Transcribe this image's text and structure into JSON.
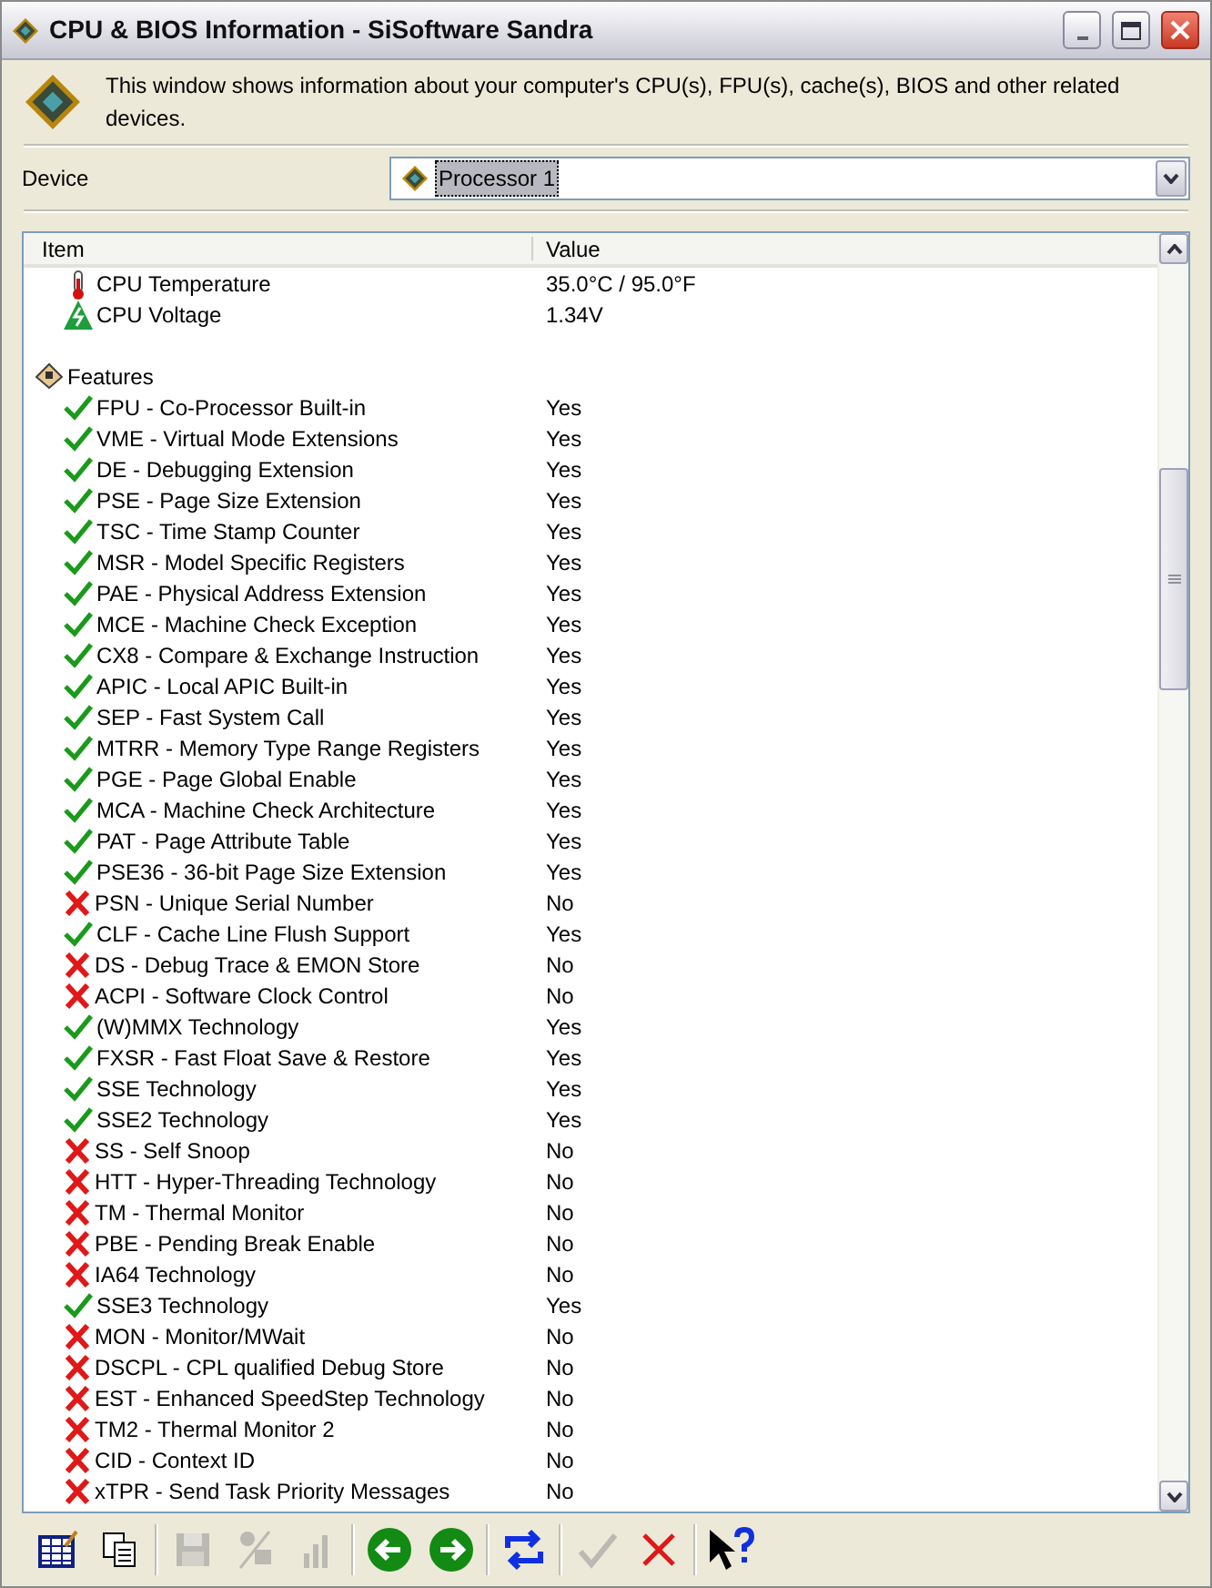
{
  "window": {
    "title": "CPU & BIOS Information - SiSoftware Sandra"
  },
  "description": "This window shows information about your computer's CPU(s), FPU(s), cache(s), BIOS and other related devices.",
  "device": {
    "label": "Device",
    "value": "Processor 1"
  },
  "table": {
    "columns": [
      "Item",
      "Value"
    ],
    "sensors": [
      {
        "kind": "temperature",
        "item": "CPU Temperature",
        "value": "35.0°C / 95.0°F"
      },
      {
        "kind": "voltage",
        "item": "CPU Voltage",
        "value": "1.34V"
      }
    ],
    "features": {
      "title": "Features",
      "items": [
        {
          "item": "FPU - Co-Processor Built-in",
          "value": "Yes",
          "supported": true
        },
        {
          "item": "VME - Virtual Mode Extensions",
          "value": "Yes",
          "supported": true
        },
        {
          "item": "DE - Debugging Extension",
          "value": "Yes",
          "supported": true
        },
        {
          "item": "PSE - Page Size Extension",
          "value": "Yes",
          "supported": true
        },
        {
          "item": "TSC - Time Stamp Counter",
          "value": "Yes",
          "supported": true
        },
        {
          "item": "MSR - Model Specific Registers",
          "value": "Yes",
          "supported": true
        },
        {
          "item": "PAE - Physical Address Extension",
          "value": "Yes",
          "supported": true
        },
        {
          "item": "MCE - Machine Check Exception",
          "value": "Yes",
          "supported": true
        },
        {
          "item": "CX8 - Compare & Exchange Instruction",
          "value": "Yes",
          "supported": true
        },
        {
          "item": "APIC - Local APIC Built-in",
          "value": "Yes",
          "supported": true
        },
        {
          "item": "SEP - Fast System Call",
          "value": "Yes",
          "supported": true
        },
        {
          "item": "MTRR - Memory Type Range Registers",
          "value": "Yes",
          "supported": true
        },
        {
          "item": "PGE - Page Global Enable",
          "value": "Yes",
          "supported": true
        },
        {
          "item": "MCA - Machine Check Architecture",
          "value": "Yes",
          "supported": true
        },
        {
          "item": "PAT - Page Attribute Table",
          "value": "Yes",
          "supported": true
        },
        {
          "item": "PSE36 - 36-bit Page Size Extension",
          "value": "Yes",
          "supported": true
        },
        {
          "item": "PSN - Unique Serial Number",
          "value": "No",
          "supported": false
        },
        {
          "item": "CLF - Cache Line Flush Support",
          "value": "Yes",
          "supported": true
        },
        {
          "item": "DS - Debug Trace & EMON Store",
          "value": "No",
          "supported": false
        },
        {
          "item": "ACPI - Software Clock Control",
          "value": "No",
          "supported": false
        },
        {
          "item": "(W)MMX Technology",
          "value": "Yes",
          "supported": true
        },
        {
          "item": "FXSR - Fast Float Save & Restore",
          "value": "Yes",
          "supported": true
        },
        {
          "item": "SSE Technology",
          "value": "Yes",
          "supported": true
        },
        {
          "item": "SSE2 Technology",
          "value": "Yes",
          "supported": true
        },
        {
          "item": "SS - Self Snoop",
          "value": "No",
          "supported": false
        },
        {
          "item": "HTT - Hyper-Threading Technology",
          "value": "No",
          "supported": false
        },
        {
          "item": "TM - Thermal Monitor",
          "value": "No",
          "supported": false
        },
        {
          "item": "PBE - Pending Break Enable",
          "value": "No",
          "supported": false
        },
        {
          "item": "IA64 Technology",
          "value": "No",
          "supported": false
        },
        {
          "item": "SSE3 Technology",
          "value": "Yes",
          "supported": true
        },
        {
          "item": "MON - Monitor/MWait",
          "value": "No",
          "supported": false
        },
        {
          "item": "DSCPL - CPL qualified Debug Store",
          "value": "No",
          "supported": false
        },
        {
          "item": "EST - Enhanced SpeedStep Technology",
          "value": "No",
          "supported": false
        },
        {
          "item": "TM2 - Thermal Monitor 2",
          "value": "No",
          "supported": false
        },
        {
          "item": "CID - Context ID",
          "value": "No",
          "supported": false
        },
        {
          "item": "xTPR - Send Task Priority Messages",
          "value": "No",
          "supported": false
        }
      ]
    }
  },
  "toolbar": [
    {
      "kind": "report",
      "disabled": false
    },
    {
      "kind": "copy",
      "disabled": false
    },
    {
      "kind": "save",
      "disabled": true
    },
    {
      "kind": "wizard",
      "disabled": true
    },
    {
      "kind": "chart",
      "disabled": true
    },
    {
      "kind": "back",
      "disabled": false
    },
    {
      "kind": "forward",
      "disabled": false
    },
    {
      "kind": "refresh",
      "disabled": false
    },
    {
      "kind": "ok",
      "disabled": true
    },
    {
      "kind": "cancel",
      "disabled": false
    },
    {
      "kind": "help",
      "disabled": false
    }
  ]
}
